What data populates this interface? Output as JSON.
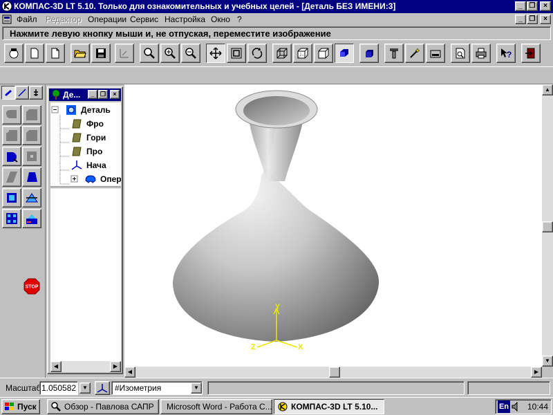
{
  "window": {
    "title": "КОМПАС-3D LT 5.10. Только для ознакомительных и учебных целей - [Деталь БЕЗ ИМЕНИ:3]",
    "minimize": "_",
    "restore": "❐",
    "close": "×"
  },
  "menu": {
    "items": [
      "Файл",
      "Редактор",
      "Операции",
      "Сервис",
      "Настройка",
      "Окно",
      "?"
    ],
    "disabled": [
      "Редактор"
    ]
  },
  "hint": "Нажмите левую кнопку мыши и, не отпуская, переместите изображение",
  "toolbar": {
    "buttons": [
      "new-document-icon",
      "new-sheet-icon",
      "open-folder-icon",
      "save-disk-icon",
      "pan-view-icon",
      "zoom-icon",
      "zoom-in-icon",
      "zoom-out-icon",
      "move-view-icon",
      "zoom-frame-icon",
      "rotate-icon",
      "wireframe-icon",
      "hidden-lines-icon",
      "thin-lines-icon",
      "shaded-icon",
      "perspective-icon",
      "tool-icon",
      "magic-wand-icon",
      "tray-icon",
      "preview-icon",
      "print-icon",
      "help-icon",
      "exit-icon"
    ],
    "pressed": [
      "move-view-icon",
      "shaded-icon"
    ]
  },
  "palette": {
    "tabs": [
      "3d-ops-tab",
      "sketch-tab",
      "measure-tab"
    ],
    "tools": [
      "extrude-boss-icon",
      "extrude-cut-icon",
      "fillet-icon",
      "chamfer-icon",
      "revolve-icon",
      "hole-icon",
      "loft-icon",
      "taper-icon",
      "shell-icon",
      "section-icon",
      "pattern-icon",
      "mirror-icon"
    ],
    "stop_label": "STOP"
  },
  "tree": {
    "title": "Де...",
    "root": "Деталь",
    "items": [
      {
        "label": "Фро",
        "icon": "plane-icon"
      },
      {
        "label": "Гори",
        "icon": "plane-icon"
      },
      {
        "label": "Про",
        "icon": "plane-icon"
      },
      {
        "label": "Нача",
        "icon": "origin-axes-icon"
      },
      {
        "label": "Опер",
        "icon": "operation-icon"
      }
    ]
  },
  "viewport": {
    "axis_x": "X",
    "axis_y": "Y",
    "axis_z": "Z",
    "colors": {
      "axes": "#e8e800",
      "background": "#ffffff"
    }
  },
  "status": {
    "scale_label": "Масштаб",
    "scale_value": "1.050582",
    "view_value": "#Изометрия"
  },
  "taskbar": {
    "start": "Пуск",
    "tasks": [
      {
        "label": "Обзор - Павлова САПР",
        "icon": "explorer-icon",
        "active": false
      },
      {
        "label": "Microsoft Word - Работа С...",
        "icon": "word-icon",
        "active": false
      },
      {
        "label": "КОМПАС-3D LT 5.10...",
        "icon": "kompas-icon",
        "active": true
      }
    ],
    "lang": "En",
    "time": "10:44"
  }
}
